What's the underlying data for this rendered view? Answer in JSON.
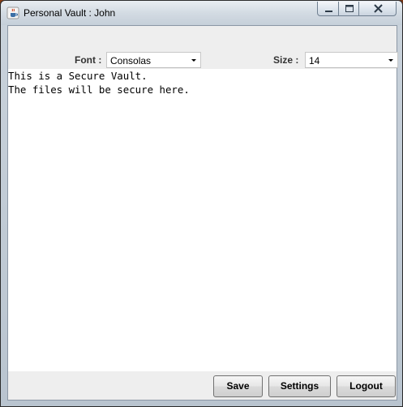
{
  "window": {
    "title": "Personal Vault : John"
  },
  "toolbar": {
    "font_label": "Font :",
    "font_value": "Consolas",
    "size_label": "Size :",
    "size_value": "14"
  },
  "editor": {
    "lines": [
      "This is a Secure Vault.",
      "The files will be secure here."
    ]
  },
  "footer": {
    "save_label": "Save",
    "settings_label": "Settings",
    "logout_label": "Logout"
  },
  "icons": {
    "app": "java-cup-icon",
    "minimize": "minimize-icon",
    "maximize": "maximize-icon",
    "close": "close-icon",
    "dropdown": "chevron-down-icon"
  }
}
